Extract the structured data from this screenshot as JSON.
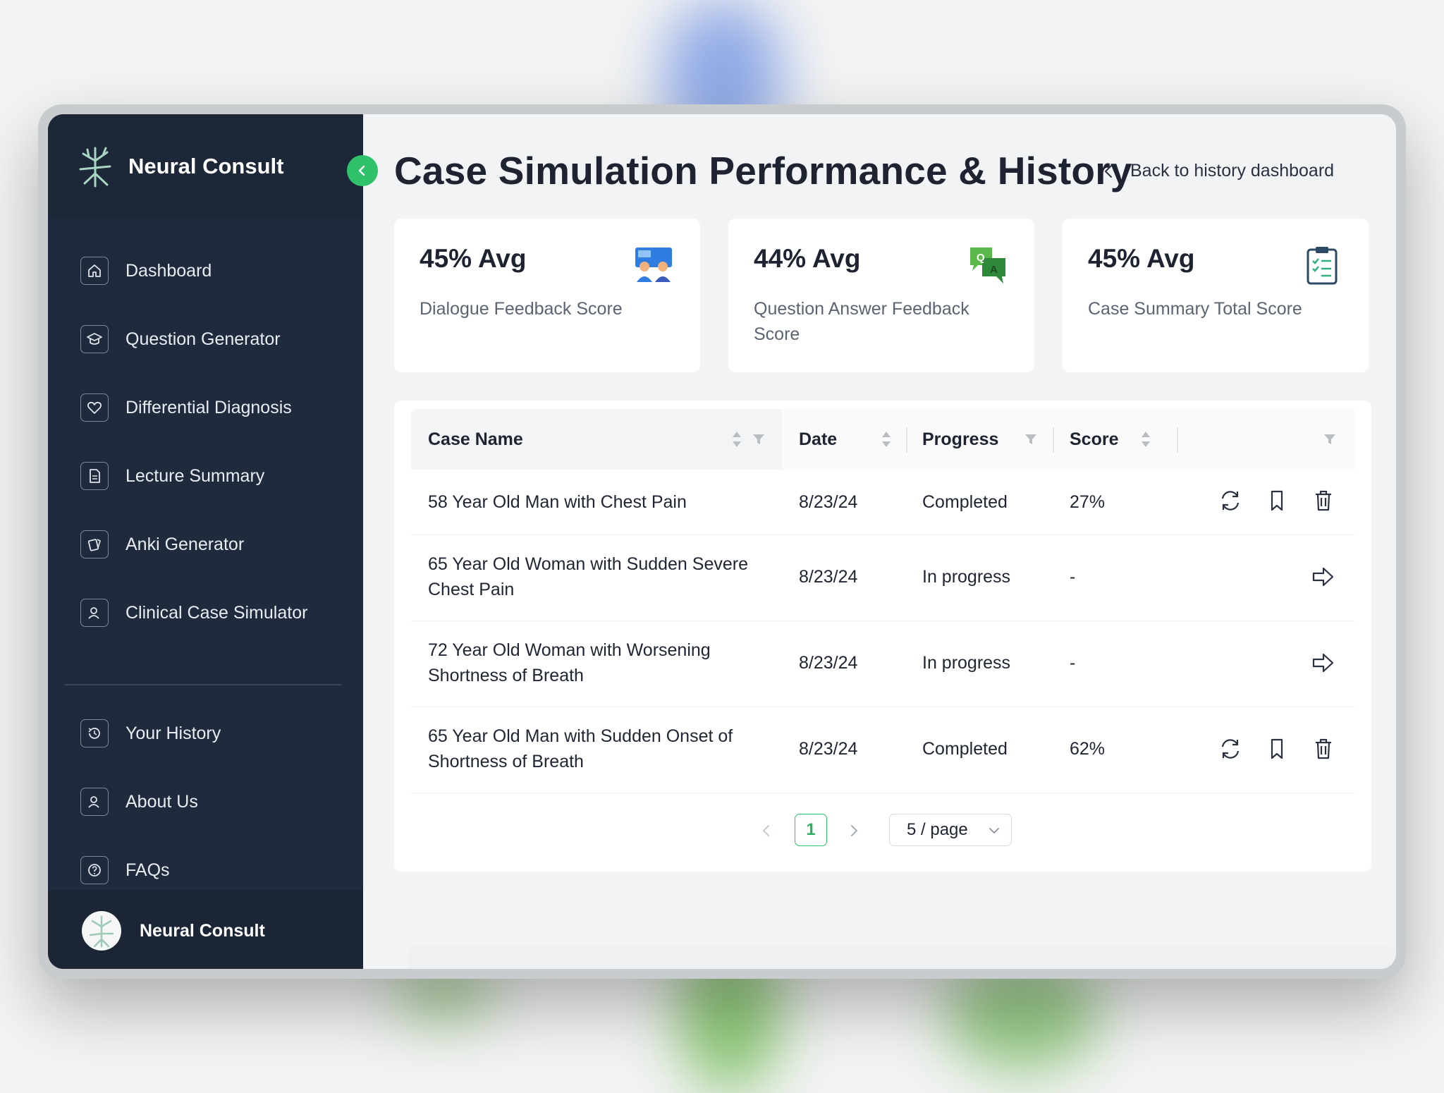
{
  "app": {
    "name": "Neural Consult"
  },
  "sidebar": {
    "brand": "Neural Consult",
    "items": [
      {
        "label": "Dashboard",
        "icon": "home-icon"
      },
      {
        "label": "Question Generator",
        "icon": "graduation-cap-icon"
      },
      {
        "label": "Differential Diagnosis",
        "icon": "heart-icon"
      },
      {
        "label": "Lecture Summary",
        "icon": "document-icon"
      },
      {
        "label": "Anki Generator",
        "icon": "cards-icon"
      },
      {
        "label": "Clinical Case Simulator",
        "icon": "users-icon"
      }
    ],
    "secondary_items": [
      {
        "label": "Your History",
        "icon": "history-icon"
      },
      {
        "label": "About Us",
        "icon": "user-icon"
      },
      {
        "label": "FAQs",
        "icon": "question-icon"
      }
    ],
    "user": {
      "name": "Neural Consult"
    }
  },
  "header": {
    "title": "Case Simulation Performance & History",
    "back_label": "Back to history dashboard"
  },
  "cards": [
    {
      "value": "45% Avg",
      "label": "Dialogue Feedback Score",
      "icon": "dialogue-people-icon"
    },
    {
      "value": "44% Avg",
      "label": "Question Answer Feedback Score",
      "icon": "qa-chat-icon"
    },
    {
      "value": "45% Avg",
      "label": "Case Summary Total Score",
      "icon": "clipboard-checklist-icon"
    }
  ],
  "table": {
    "columns": [
      "Case Name",
      "Date",
      "Progress",
      "Score"
    ],
    "rows": [
      {
        "name_line1": "58 Year Old Man with Chest Pain",
        "name_line2": "",
        "date": "8/23/24",
        "progress": "Completed",
        "score": "27%"
      },
      {
        "name_line1": "65 Year Old Woman with Sudden Severe",
        "name_line2": "Chest Pain",
        "date": "8/23/24",
        "progress": "In progress",
        "score": "-"
      },
      {
        "name_line1": "72 Year Old Woman with Worsening",
        "name_line2": "Shortness of Breath",
        "date": "8/23/24",
        "progress": "In progress",
        "score": "-"
      },
      {
        "name_line1": "65 Year Old Man with Sudden Onset of",
        "name_line2": "Shortness of Breath",
        "date": "8/23/24",
        "progress": "Completed",
        "score": "62%"
      }
    ]
  },
  "pagination": {
    "current_page": "1",
    "page_size": "5 / page"
  },
  "colors": {
    "sidebar": "#1f2b3d",
    "accent": "#2fc26b",
    "background": "#f2f3f5"
  }
}
